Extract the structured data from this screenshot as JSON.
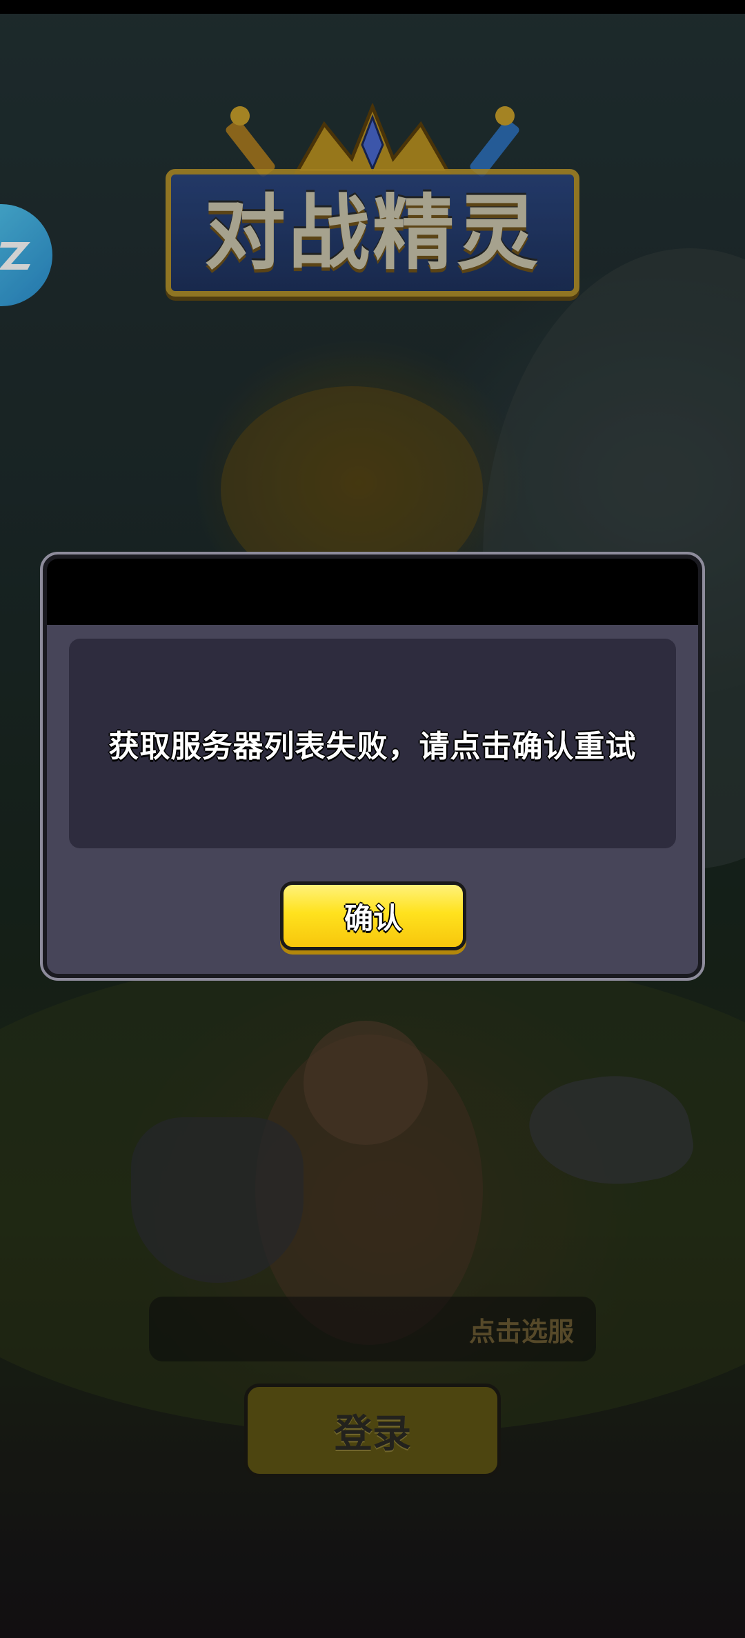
{
  "game": {
    "logo_text": "对战精灵"
  },
  "login_screen": {
    "server_select_label": "点击选服",
    "login_label": "登录"
  },
  "dialog": {
    "message": "获取服务器列表失败，请点击确认重试",
    "confirm_label": "确认"
  },
  "side_float": {
    "icon": "z-logo-icon",
    "color": "#3aa8e4"
  },
  "colors": {
    "confirm_button": "#ffe21e",
    "dialog_bg": "#474559",
    "login_button": "#5f5514"
  }
}
